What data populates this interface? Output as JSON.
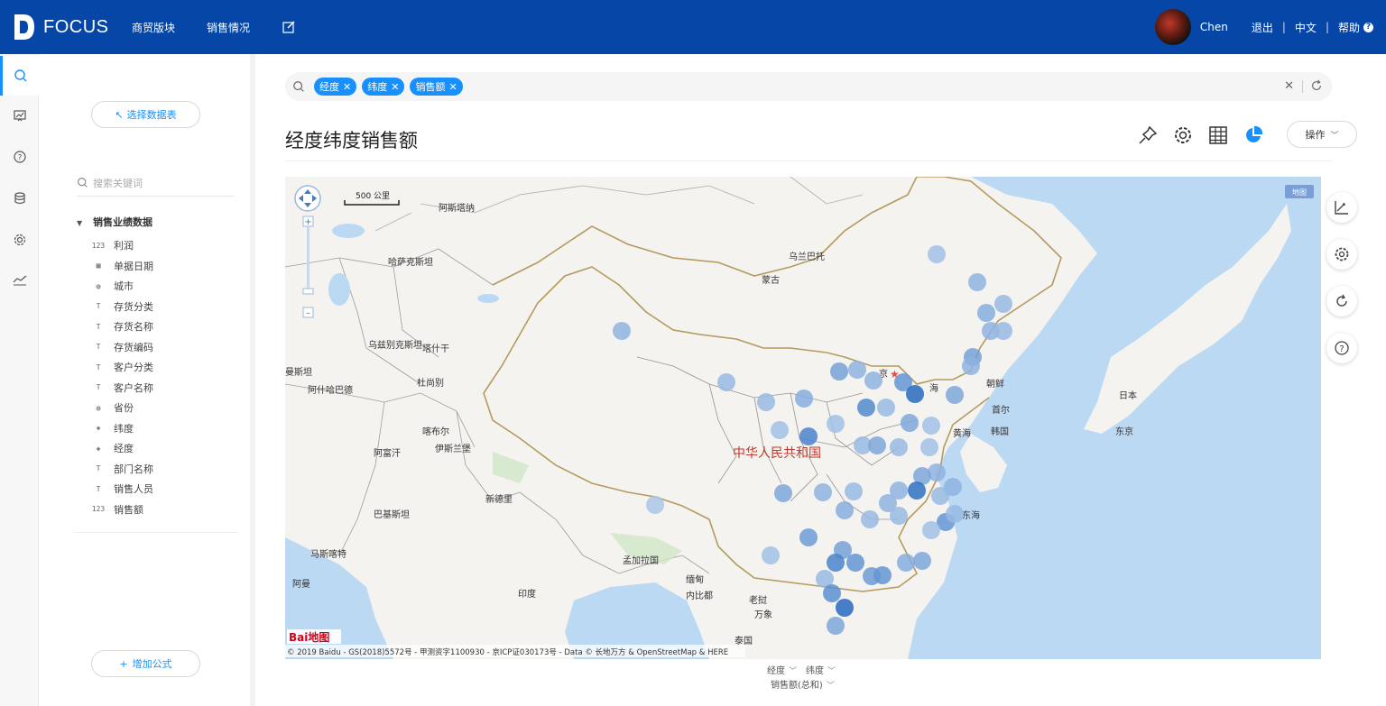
{
  "topbar": {
    "logo_text": "FOCUS",
    "nav": [
      "商贸版块",
      "销售情况"
    ],
    "user": "Chen",
    "logout": "退出",
    "language": "中文",
    "help": "帮助"
  },
  "rail": {
    "icons": [
      "search-icon",
      "board-icon",
      "question-icon",
      "database-icon",
      "settings-icon",
      "trend-icon"
    ]
  },
  "panel": {
    "select_table": "选择数据表",
    "search_placeholder": "搜索关键词",
    "group": "销售业绩数据",
    "fields": [
      {
        "label": "利润",
        "type": "number"
      },
      {
        "label": "单据日期",
        "type": "date"
      },
      {
        "label": "城市",
        "type": "geo"
      },
      {
        "label": "存货分类",
        "type": "text"
      },
      {
        "label": "存货名称",
        "type": "text"
      },
      {
        "label": "存货编码",
        "type": "text"
      },
      {
        "label": "客户分类",
        "type": "text"
      },
      {
        "label": "客户名称",
        "type": "text"
      },
      {
        "label": "省份",
        "type": "geo"
      },
      {
        "label": "纬度",
        "type": "coord"
      },
      {
        "label": "经度",
        "type": "coord"
      },
      {
        "label": "部门名称",
        "type": "text"
      },
      {
        "label": "销售人员",
        "type": "text"
      },
      {
        "label": "销售额",
        "type": "number"
      }
    ],
    "add_formula": "增加公式"
  },
  "search": {
    "tags": [
      "经度",
      "纬度",
      "销售额"
    ]
  },
  "page_title": "经度纬度销售额",
  "operate_button": "操作",
  "map": {
    "badge": "地图",
    "scale": "500 公里",
    "copyright": "© 2019 Baidu - GS(2018)5572号 - 甲测资字1100930 - 京ICP证030173号 - Data © 长地万方 & OpenStreetMap & HERE",
    "baidu_logo": "Bai地图",
    "labels": {
      "mongolia": "蒙古",
      "ulaanbaatar": "乌兰巴托",
      "kazakhstan": "哈萨克斯坦",
      "astana": "阿斯塔纳",
      "uzbekistan": "乌兹别克斯坦",
      "tashkent": "塔什干",
      "turkmenistan": "曼斯坦",
      "ashgabat": "阿什哈巴德",
      "dushanbe": "杜尚别",
      "kabul": "喀布尔",
      "islamabad": "伊斯兰堡",
      "afghanistan": "阿富汗",
      "pakistan": "巴基斯坦",
      "newdelhi": "新德里",
      "muscat": "马斯喀特",
      "oman": "阿曼",
      "india": "印度",
      "kolkata": "孟加拉国",
      "myanmar": "缅甸",
      "naypyidaw": "内比都",
      "laos": "老挝",
      "vientiane": "万象",
      "thailand": "泰国",
      "china": "中华人民共和国",
      "beijing": "京",
      "korea_n": "朝鲜",
      "pyongyang": "首尔",
      "korea_s": "韩国",
      "japan": "日本",
      "tokyo": "东京",
      "yellow_sea": "黄海",
      "east_sea": "东海",
      "bohai": "海"
    }
  },
  "axis_controls": {
    "x": "经度",
    "y": "纬度",
    "value": "销售额(总和)"
  },
  "colors": {
    "brand": "#0546a6",
    "accent": "#1890ff",
    "sea": "#bcd9f4"
  }
}
